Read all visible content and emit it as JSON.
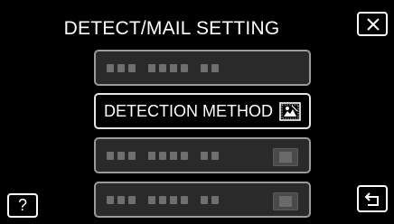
{
  "header": {
    "title": "DETECT/MAIL SETTING"
  },
  "menu": {
    "items": [
      {
        "label": "",
        "state": "disabled",
        "has_icon": false
      },
      {
        "label": "DETECTION METHOD",
        "state": "enabled",
        "icon": "detection-method-icon"
      },
      {
        "label": "",
        "state": "disabled",
        "has_icon": true,
        "icon": "placeholder-icon"
      },
      {
        "label": "",
        "state": "disabled",
        "has_icon": true,
        "icon": "placeholder-icon"
      }
    ]
  },
  "buttons": {
    "close_icon": "close-icon",
    "help_label": "?",
    "back_icon": "return-arrow-icon"
  },
  "colors": {
    "background": "#000000",
    "text": "#ffffff",
    "disabled_fill": "#2a2a2a",
    "disabled_border": "#9a9a9a"
  }
}
